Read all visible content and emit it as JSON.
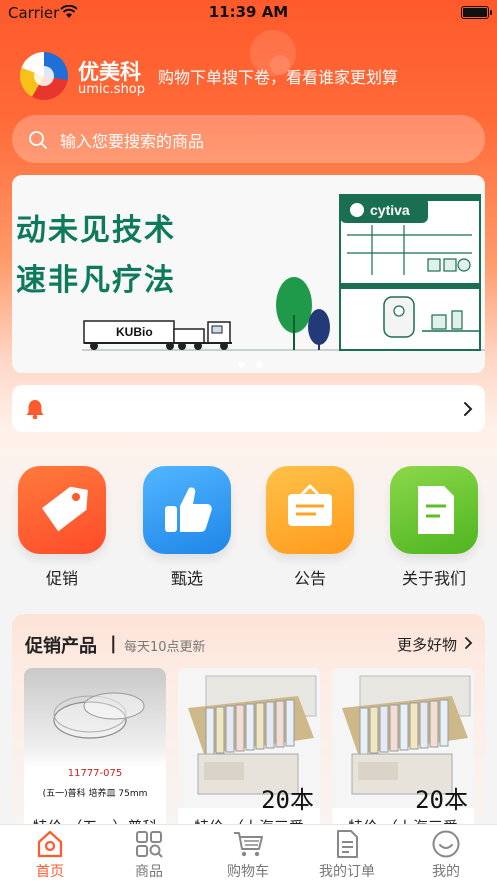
{
  "status_bar": {
    "carrier": "Carrier",
    "time": "11:39 AM"
  },
  "header": {
    "brand_cn": "优美科",
    "brand_en": "umic.shop",
    "slogan": "购物下单搜下卷，看看谁家更划算"
  },
  "search": {
    "placeholder": "输入您要搜索的商品"
  },
  "banner": {
    "line1": "动未见技术",
    "line2": "速非凡疗法",
    "brand": "cytiva",
    "truck_label": "KUBio"
  },
  "categories": [
    {
      "label": "促销",
      "icon": "tag-icon",
      "color": "#ff5a2c"
    },
    {
      "label": "甄选",
      "icon": "thumbs-up-icon",
      "color": "#2a8ff0"
    },
    {
      "label": "公告",
      "icon": "notice-board-icon",
      "color": "#ffa526"
    },
    {
      "label": "关于我们",
      "icon": "document-icon",
      "color": "#5cbf28"
    }
  ],
  "promo": {
    "title": "促销产品",
    "separator": "|",
    "subtitle": "每天10点更新",
    "more": "更多好物",
    "cards": [
      {
        "code": "11777-075",
        "name": "(五一)普科 培养皿 75mm",
        "caption": "特价 （五一）普科"
      },
      {
        "badge": "20本",
        "caption": "特价 （上海三爱"
      },
      {
        "badge": "20本",
        "caption": "特价 （上海三爱"
      }
    ]
  },
  "tabbar": {
    "active_color": "#ff5a2c",
    "items": [
      {
        "label": "首页",
        "icon": "home-icon"
      },
      {
        "label": "商品",
        "icon": "grid-search-icon"
      },
      {
        "label": "购物车",
        "icon": "cart-icon"
      },
      {
        "label": "我的订单",
        "icon": "order-icon"
      },
      {
        "label": "我的",
        "icon": "smile-icon"
      }
    ]
  }
}
